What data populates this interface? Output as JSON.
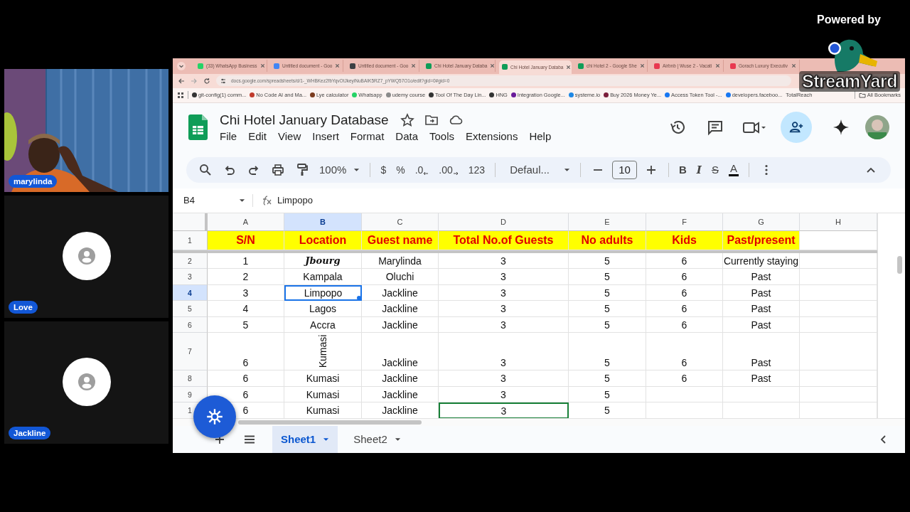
{
  "overlay": {
    "powered_by": "Powered by",
    "brand": "StreamYard"
  },
  "participants": [
    {
      "name": "marylinda",
      "kind": "video"
    },
    {
      "name": "Love",
      "kind": "avatar"
    },
    {
      "name": "Jackline",
      "kind": "avatar"
    }
  ],
  "browser": {
    "tabs": [
      {
        "label": "(33) WhatsApp Business",
        "selected": false,
        "color": "#25d366"
      },
      {
        "label": "Untitled document - Goo",
        "selected": false,
        "color": "#4285f4"
      },
      {
        "label": "Untitled document - Goo",
        "selected": false,
        "color": "#3c4043"
      },
      {
        "label": "Chi Hotel January Databa",
        "selected": false,
        "color": "#0f9d58"
      },
      {
        "label": "Chi Hotel January Databa",
        "selected": true,
        "color": "#0f9d58"
      },
      {
        "label": "chi Hotel 2 - Google She",
        "selected": false,
        "color": "#0f9d58"
      },
      {
        "label": "Airbnb | Wuse 2 - Vacati",
        "selected": false,
        "color": "#e8384f"
      },
      {
        "label": "Gorach Luxury Executiv",
        "selected": false,
        "color": "#e8384f"
      }
    ],
    "url": "docs.google.com/spreadsheets/d/1-_WHBKez2fbYqvOtJkeyiNuBAIK5RZ7_pYWQ57O1o/edit?gid=0#gid=0",
    "bookmarks": [
      {
        "label": "git-config(1) comm...",
        "color": "#333333"
      },
      {
        "label": "No Code AI and Ma...",
        "color": "#c0392b"
      },
      {
        "label": "Lye calculator",
        "color": "#7a3b1e"
      },
      {
        "label": "Whatsapp",
        "color": "#25d366"
      },
      {
        "label": "udemy course",
        "color": "#8a8a8a"
      },
      {
        "label": "Tool Of The Day Lin...",
        "color": "#333333"
      },
      {
        "label": "HNG",
        "color": "#333333"
      },
      {
        "label": "Integration Google...",
        "color": "#6a1b9a"
      },
      {
        "label": "systeme.io",
        "color": "#1e88e5"
      },
      {
        "label": "Buy 2026 Money Ye...",
        "color": "#7b1e3a"
      },
      {
        "label": "Access Token Tool -...",
        "color": "#1877f2"
      },
      {
        "label": "developers.faceboo...",
        "color": "#1877f2"
      },
      {
        "label": "TotalReach"
      }
    ],
    "all_bookmarks": "All Bookmarks"
  },
  "sheet": {
    "title": "Chi Hotel January Database",
    "menu": [
      "File",
      "Edit",
      "View",
      "Insert",
      "Format",
      "Data",
      "Tools",
      "Extensions",
      "Help"
    ],
    "toolbar": {
      "zoom": "100%",
      "currency": "$",
      "percent": "%",
      "decrease_decimal": ".0",
      "increase_decimal": ".00",
      "number_format": "123",
      "font": "Defaul...",
      "font_size": "10",
      "bold": "B",
      "italic": "I",
      "strikethrough": "S",
      "text_color": "A"
    },
    "name_box": "B4",
    "formula": "Limpopo",
    "columns": [
      {
        "label": "A",
        "selected": false
      },
      {
        "label": "B",
        "selected": true
      },
      {
        "label": "C",
        "selected": false
      },
      {
        "label": "D",
        "selected": false
      },
      {
        "label": "E",
        "selected": false
      },
      {
        "label": "F",
        "selected": false
      },
      {
        "label": "G",
        "selected": false
      },
      {
        "label": "H",
        "selected": false
      }
    ],
    "rows": [
      {
        "number": "1",
        "selected": false,
        "kind": "header",
        "cells": [
          {
            "text": "S/N",
            "kind": "plain"
          },
          {
            "text": "Location",
            "kind": "plain"
          },
          {
            "text": "Guest name",
            "kind": "plain"
          },
          {
            "text": "Total No.of Guests",
            "kind": "plain"
          },
          {
            "text": "No adults",
            "kind": "plain"
          },
          {
            "text": "Kids",
            "kind": "plain"
          },
          {
            "text": "Past/present",
            "kind": "plain"
          }
        ]
      },
      {
        "number": "2",
        "selected": false,
        "kind": "normal",
        "cells": [
          {
            "text": "1",
            "kind": "plain"
          },
          {
            "text": "Jbourg",
            "kind": "script"
          },
          {
            "text": "Marylinda",
            "kind": "plain"
          },
          {
            "text": "3",
            "kind": "plain"
          },
          {
            "text": "5",
            "kind": "plain"
          },
          {
            "text": "6",
            "kind": "plain"
          },
          {
            "text": "Currently staying",
            "kind": "plain"
          }
        ]
      },
      {
        "number": "3",
        "selected": false,
        "kind": "normal",
        "cells": [
          {
            "text": "2",
            "kind": "plain"
          },
          {
            "text": "Kampala",
            "kind": "plain"
          },
          {
            "text": "Oluchi",
            "kind": "plain"
          },
          {
            "text": "3",
            "kind": "plain"
          },
          {
            "text": "5",
            "kind": "plain"
          },
          {
            "text": "6",
            "kind": "plain"
          },
          {
            "text": "Past",
            "kind": "plain"
          }
        ]
      },
      {
        "number": "4",
        "selected": true,
        "kind": "normal",
        "cells": [
          {
            "text": "3",
            "kind": "plain"
          },
          {
            "text": "Limpopo",
            "kind": "plain"
          },
          {
            "text": "Jackline",
            "kind": "plain"
          },
          {
            "text": "3",
            "kind": "plain"
          },
          {
            "text": "5",
            "kind": "plain"
          },
          {
            "text": "6",
            "kind": "plain"
          },
          {
            "text": "Past",
            "kind": "plain"
          }
        ]
      },
      {
        "number": "5",
        "selected": false,
        "kind": "normal",
        "cells": [
          {
            "text": "4",
            "kind": "plain"
          },
          {
            "text": "Lagos",
            "kind": "plain"
          },
          {
            "text": "Jackline",
            "kind": "plain"
          },
          {
            "text": "3",
            "kind": "plain"
          },
          {
            "text": "5",
            "kind": "plain"
          },
          {
            "text": "6",
            "kind": "plain"
          },
          {
            "text": "Past",
            "kind": "plain"
          }
        ]
      },
      {
        "number": "6",
        "selected": false,
        "kind": "normal",
        "cells": [
          {
            "text": "5",
            "kind": "plain"
          },
          {
            "text": "Accra",
            "kind": "plain"
          },
          {
            "text": "Jackline",
            "kind": "plain"
          },
          {
            "text": "3",
            "kind": "plain"
          },
          {
            "text": "5",
            "kind": "plain"
          },
          {
            "text": "6",
            "kind": "plain"
          },
          {
            "text": "Past",
            "kind": "plain"
          }
        ]
      },
      {
        "number": "7",
        "selected": false,
        "kind": "tall",
        "cells": [
          {
            "text": "6",
            "kind": "plain"
          },
          {
            "text": "Kumasi",
            "kind": "vertical"
          },
          {
            "text": "Jackline",
            "kind": "plain"
          },
          {
            "text": "3",
            "kind": "plain"
          },
          {
            "text": "5",
            "kind": "plain"
          },
          {
            "text": "6",
            "kind": "plain"
          },
          {
            "text": "Past",
            "kind": "plain"
          }
        ]
      },
      {
        "number": "8",
        "selected": false,
        "kind": "normal",
        "cells": [
          {
            "text": "6",
            "kind": "plain"
          },
          {
            "text": "Kumasi",
            "kind": "plain"
          },
          {
            "text": "Jackline",
            "kind": "plain"
          },
          {
            "text": "3",
            "kind": "plain"
          },
          {
            "text": "5",
            "kind": "plain"
          },
          {
            "text": "6",
            "kind": "plain"
          },
          {
            "text": "Past",
            "kind": "plain"
          }
        ]
      },
      {
        "number": "9",
        "selected": false,
        "kind": "normal",
        "cells": [
          {
            "text": "6",
            "kind": "plain"
          },
          {
            "text": "Kumasi",
            "kind": "plain"
          },
          {
            "text": "Jackline",
            "kind": "plain"
          },
          {
            "text": "3",
            "kind": "plain"
          },
          {
            "text": "5",
            "kind": "plain"
          }
        ]
      },
      {
        "number": "1",
        "selected": false,
        "kind": "normal",
        "cells": [
          {
            "text": "6",
            "kind": "plain"
          },
          {
            "text": "Kumasi",
            "kind": "plain"
          },
          {
            "text": "Jackline",
            "kind": "plain"
          },
          {
            "text": "3",
            "kind": "peer_cursor"
          },
          {
            "text": "5",
            "kind": "plain"
          }
        ]
      }
    ],
    "tabs": [
      {
        "label": "Sheet1",
        "selected": true
      },
      {
        "label": "Sheet2",
        "selected": false
      }
    ]
  }
}
